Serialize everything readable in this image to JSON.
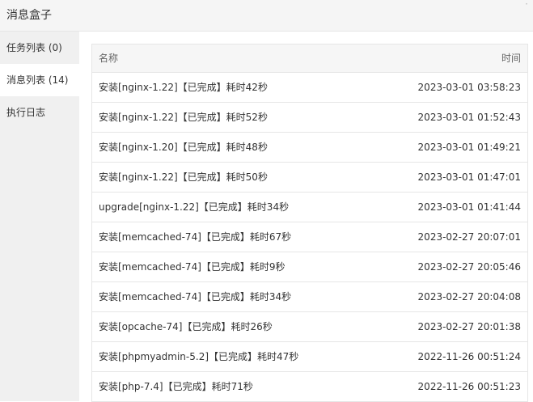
{
  "window": {
    "title": "消息盒子"
  },
  "sidebar": {
    "items": [
      {
        "label": "任务列表 (0)"
      },
      {
        "label": "消息列表 (14)"
      },
      {
        "label": "执行日志"
      }
    ]
  },
  "table": {
    "headers": {
      "name": "名称",
      "time": "时间"
    },
    "rows": [
      {
        "name": "安装[nginx-1.22]【已完成】耗时42秒",
        "time": "2023-03-01 03:58:23"
      },
      {
        "name": "安装[nginx-1.22]【已完成】耗时52秒",
        "time": "2023-03-01 01:52:43"
      },
      {
        "name": "安装[nginx-1.20]【已完成】耗时48秒",
        "time": "2023-03-01 01:49:21"
      },
      {
        "name": "安装[nginx-1.22]【已完成】耗时50秒",
        "time": "2023-03-01 01:47:01"
      },
      {
        "name": "upgrade[nginx-1.22]【已完成】耗时34秒",
        "time": "2023-03-01 01:41:44"
      },
      {
        "name": "安装[memcached-74]【已完成】耗时67秒",
        "time": "2023-02-27 20:07:01"
      },
      {
        "name": "安装[memcached-74]【已完成】耗时9秒",
        "time": "2023-02-27 20:05:46"
      },
      {
        "name": "安装[memcached-74]【已完成】耗时34秒",
        "time": "2023-02-27 20:04:08"
      },
      {
        "name": "安装[opcache-74]【已完成】耗时26秒",
        "time": "2023-02-27 20:01:38"
      },
      {
        "name": "安装[phpmyadmin-5.2]【已完成】耗时47秒",
        "time": "2022-11-26 00:51:24"
      },
      {
        "name": "安装[php-7.4]【已完成】耗时71秒",
        "time": "2022-11-26 00:51:23"
      }
    ]
  }
}
